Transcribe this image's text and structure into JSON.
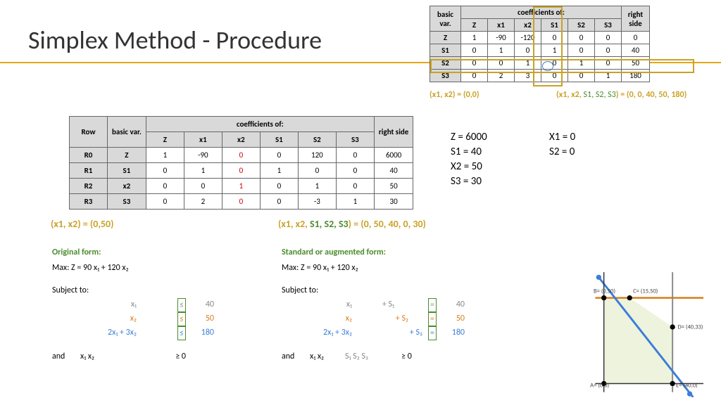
{
  "title": "Simplex Method - Procedure",
  "smallTable": {
    "headers": [
      "basic var.",
      "coefficients of:",
      "right side"
    ],
    "cols": [
      "Z",
      "x1",
      "x2",
      "S1",
      "S2",
      "S3"
    ],
    "rows": [
      {
        "bv": "Z",
        "Z": "1",
        "x1": "-90",
        "x2": "-120",
        "S1": "0",
        "S2": "0",
        "S3": "0",
        "rs": "0"
      },
      {
        "bv": "S1",
        "Z": "0",
        "x1": "1",
        "x2": "0",
        "S1": "1",
        "S2": "0",
        "S3": "0",
        "rs": "40"
      },
      {
        "bv": "S2",
        "Z": "0",
        "x1": "0",
        "x2": "1",
        "S1": "0",
        "S2": "1",
        "S3": "0",
        "rs": "50"
      },
      {
        "bv": "S3",
        "Z": "0",
        "x1": "2",
        "x2": "3",
        "S1": "0",
        "S2": "0",
        "S3": "1",
        "rs": "180"
      }
    ]
  },
  "smallAnnot1": "(x1, x2) = (0,0)",
  "smallAnnot2_pre": "(x1, x2, ",
  "smallAnnot2_s": "S1, S2, S3",
  "smallAnnot2_post": ") = (0, 0, 40, 50, 180)",
  "bigTable": {
    "rowLabel": "Row",
    "bvLabel": "basic var.",
    "coefLabel": "coefficients of:",
    "rsLabel": "right side",
    "cols": [
      "Z",
      "x1",
      "x2",
      "S1",
      "S2",
      "S3"
    ],
    "rows": [
      {
        "row": "R0",
        "bv": "Z",
        "Z": "1",
        "x1": "-90",
        "x2": "0",
        "S1": "0",
        "S2": "120",
        "S3": "0",
        "rs": "6000"
      },
      {
        "row": "R1",
        "bv": "S1",
        "Z": "0",
        "x1": "1",
        "x2": "0",
        "S1": "1",
        "S2": "0",
        "S3": "0",
        "rs": "40"
      },
      {
        "row": "R2",
        "bv": "x2",
        "Z": "0",
        "x1": "0",
        "x2": "1",
        "S1": "0",
        "S2": "1",
        "S3": "0",
        "rs": "50"
      },
      {
        "row": "R3",
        "bv": "S3",
        "Z": "0",
        "x1": "2",
        "x2": "0",
        "S1": "0",
        "S2": "-3",
        "S3": "1",
        "rs": "30"
      }
    ]
  },
  "bigAnnot1": "(x1, x2) = (0,50)",
  "bigAnnot2_pre": "(x1, x2, ",
  "bigAnnot2_s": "S1, S2, S3",
  "bigAnnot2_post": ") = (0, 50, 40, 0, 30)",
  "values": {
    "z": "Z = 6000",
    "s1": "S1 = 40",
    "x2": "X2 = 50",
    "s3": "S3 = 30",
    "x1": "X1 = 0",
    "s2": "S2 = 0"
  },
  "originalTitle": "Original form:",
  "stdTitle": "Standard or augmented form:",
  "maxLine": "Max:    Z = 90 x₁ + 120 x₂",
  "subjectTo": "Subject to:",
  "orig": {
    "c1_lhs": "x₁",
    "c1_op": "≤",
    "c1_rhs": "40",
    "c2_lhs": "x₂",
    "c2_op": "≤",
    "c2_rhs": "50",
    "c3_lhs": "2x₁ + 3x₂",
    "c3_op": "≤",
    "c3_rhs": "180",
    "and": "and",
    "nn": "x₁  x₂",
    "nn_op": "≥ 0"
  },
  "std": {
    "c1_lhs": "x₁",
    "c1_s": "+ S₁",
    "c1_op": "=",
    "c1_rhs": "40",
    "c2_lhs": "x₂",
    "c2_s": "+ S₂",
    "c2_op": "=",
    "c2_rhs": "50",
    "c3_lhs": "2x₁ + 3x₂",
    "c3_s": "+ S₃",
    "c3_op": "=",
    "c3_rhs": "180",
    "and": "and",
    "nn": "x₁  x₂",
    "nn_s": "S₁  S₂  S₃",
    "nn_op": "≥ 0"
  },
  "chart_data": {
    "type": "line",
    "title": "",
    "xlabel": "",
    "ylabel": "",
    "xlim": [
      0,
      50
    ],
    "ylim": [
      0,
      60
    ],
    "feasible_region_vertices": [
      [
        0,
        0
      ],
      [
        40,
        0
      ],
      [
        40,
        33
      ],
      [
        15,
        50
      ],
      [
        0,
        50
      ]
    ],
    "points": [
      {
        "name": "A",
        "label": "A= (0,0)",
        "x": 0,
        "y": 0
      },
      {
        "name": "B",
        "label": "B= (0,50)",
        "x": 0,
        "y": 50
      },
      {
        "name": "C",
        "label": "C= (15,50)",
        "x": 15,
        "y": 50
      },
      {
        "name": "D",
        "label": "D= (40,33)",
        "x": 40,
        "y": 33
      },
      {
        "name": "E",
        "label": "E= (40,0)",
        "x": 40,
        "y": 0
      }
    ],
    "lines": [
      {
        "name": "y=50",
        "color": "#d97d1a",
        "p1": [
          -5,
          50
        ],
        "p2": [
          55,
          50
        ]
      },
      {
        "name": "x=40",
        "color": "#888",
        "p1": [
          40,
          -5
        ],
        "p2": [
          40,
          65
        ]
      },
      {
        "name": "2x+3y=180",
        "color": "#3b7dd8",
        "p1": [
          0,
          60
        ],
        "p2": [
          50,
          -6
        ]
      }
    ]
  }
}
